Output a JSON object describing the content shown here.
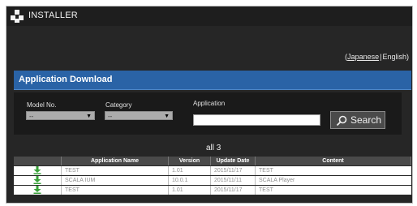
{
  "header": {
    "title": "INSTALLER"
  },
  "language": {
    "open": "(",
    "japanese": "Japanese",
    "separator": "|",
    "english": "English",
    "close": ")"
  },
  "section": {
    "title": "Application Download"
  },
  "filters": {
    "model_label": "Model No.",
    "model_value": "--",
    "category_label": "Category",
    "category_value": "--",
    "application_label": "Application",
    "application_value": "",
    "search_label": "Search"
  },
  "results": {
    "count_text": "all 3"
  },
  "table": {
    "columns": [
      "",
      "Application Name",
      "Version",
      "Update Date",
      "Content"
    ],
    "rows": [
      {
        "name": "TEST",
        "version": "1.01",
        "date": "2015/11/17",
        "content": "TEST"
      },
      {
        "name": "SCALA IUM",
        "version": "10.0.1",
        "date": "2015/11/11",
        "content": "SCALA Player"
      },
      {
        "name": "TEST",
        "version": "1.01",
        "date": "2015/11/17",
        "content": "TEST"
      }
    ]
  },
  "colors": {
    "accent": "#2a63a6",
    "download_icon": "#3aa23a",
    "background": "#262626"
  }
}
